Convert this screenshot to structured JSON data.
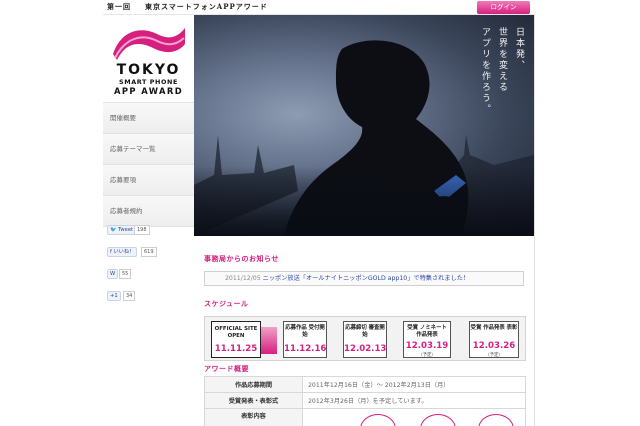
{
  "header": {
    "series": "第一回",
    "title": "東京スマートフォンAPPアワード",
    "login_label": "ログイン"
  },
  "logo": {
    "line1": "TOKYO",
    "line2": "SMART PHONE",
    "line3": "APP AWARD",
    "accent_color": "#d6207f"
  },
  "sidebar": {
    "items": [
      {
        "label": "開催概要"
      },
      {
        "label": "応募テーマ一覧"
      },
      {
        "label": "応募要項"
      },
      {
        "label": "応募者規約"
      }
    ]
  },
  "social": {
    "tweet": {
      "label": "Tweet",
      "count": "198"
    },
    "like": {
      "label": "いいね！",
      "count": "619"
    },
    "other": {
      "count": "55"
    },
    "plus": {
      "label": "+1",
      "count": "34"
    }
  },
  "hero": {
    "catchphrase": [
      "日本発、",
      "世界を変える",
      "アプリを作ろう。"
    ]
  },
  "notice": {
    "title": "事務局からのお知らせ",
    "date": "2011/12/05",
    "text": "ニッポン放送「オールナイトニッポンGOLD app10」で特集されました！"
  },
  "schedule": {
    "title": "スケジュール",
    "stages": [
      {
        "label": "OFFICIAL SITE OPEN",
        "date": "11.11.25",
        "note": ""
      },
      {
        "label": "応募作品 受付開始",
        "date": "11.12.16",
        "note": ""
      },
      {
        "label": "応募締切 審査開始",
        "date": "12.02.13",
        "note": ""
      },
      {
        "label": "受賞 ノミネート 作品発表",
        "date": "12.03.19",
        "note": "（予定）"
      },
      {
        "label": "受賞 作品発表 表彰",
        "date": "12.03.26",
        "note": "（予定）"
      }
    ]
  },
  "award": {
    "title": "アワード概要",
    "rows": [
      {
        "key": "作品応募期間",
        "value": "2011年12月16日（金）～ 2012年2月13日（月）"
      },
      {
        "key": "受賞発表・表彰式",
        "value": "2012年3月26日（月）を予定しています。"
      },
      {
        "key": "表彰内容",
        "value": ""
      }
    ]
  }
}
